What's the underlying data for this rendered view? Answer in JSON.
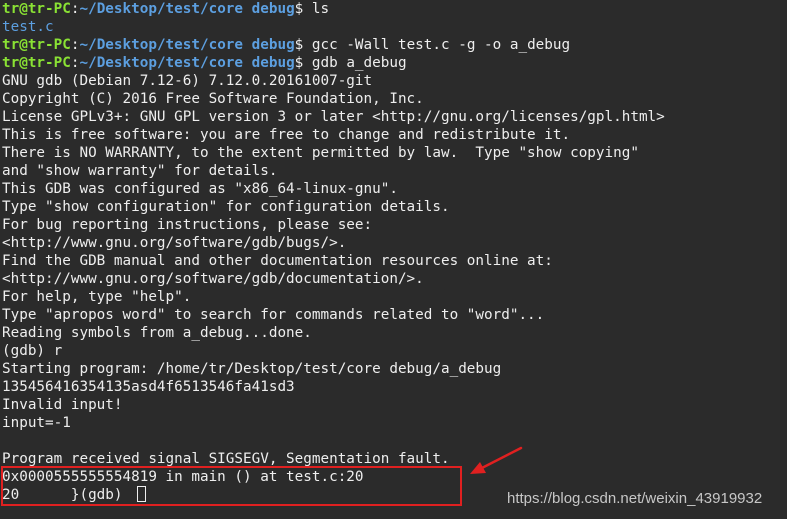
{
  "terminal": {
    "prompt_user_host": "tr@tr-PC",
    "prompt_colon": ":",
    "prompt_path": "~/Desktop/test/core debug",
    "prompt_dollar": "$ ",
    "commands": {
      "ls": "ls",
      "gcc": "gcc -Wall test.c -g -o a_debug",
      "gdb": "gdb a_debug"
    },
    "ls_output": "test.c",
    "gdb_banner": [
      "GNU gdb (Debian 7.12-6) 7.12.0.20161007-git",
      "Copyright (C) 2016 Free Software Foundation, Inc.",
      "License GPLv3+: GNU GPL version 3 or later <http://gnu.org/licenses/gpl.html>",
      "This is free software: you are free to change and redistribute it.",
      "There is NO WARRANTY, to the extent permitted by law.  Type \"show copying\"",
      "and \"show warranty\" for details.",
      "This GDB was configured as \"x86_64-linux-gnu\".",
      "Type \"show configuration\" for configuration details.",
      "For bug reporting instructions, please see:",
      "<http://www.gnu.org/software/gdb/bugs/>.",
      "Find the GDB manual and other documentation resources online at:",
      "<http://www.gnu.org/software/gdb/documentation/>.",
      "For help, type \"help\".",
      "Type \"apropos word\" to search for commands related to \"word\"...",
      "Reading symbols from a_debug...done."
    ],
    "gdb_run_cmd": "(gdb) r",
    "run_output": [
      "Starting program: /home/tr/Desktop/test/core debug/a_debug",
      "135456416354135asd4f6513546fa41sd3",
      "Invalid input!",
      "input=-1",
      "",
      "Program received signal SIGSEGV, Segmentation fault."
    ],
    "fault_location": "0x0000555555554819 in main () at test.c:20",
    "fault_source_line": "20      }(gdb) "
  },
  "annotation": {
    "box_color": "#e02020",
    "arrow_color": "#e02020"
  },
  "watermark": "https://blog.csdn.net/weixin_43919932"
}
